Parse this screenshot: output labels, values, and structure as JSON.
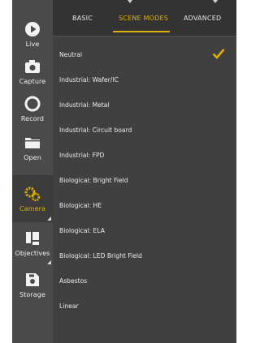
{
  "sidebar": {
    "items": [
      {
        "label": "Live",
        "icon": "play-icon"
      },
      {
        "label": "Capture",
        "icon": "camera-icon"
      },
      {
        "label": "Record",
        "icon": "record-icon"
      },
      {
        "label": "Open",
        "icon": "folder-icon"
      },
      {
        "label": "Camera",
        "icon": "camera-settings-icon",
        "active": true
      },
      {
        "label": "Objectives",
        "icon": "objectives-icon"
      },
      {
        "label": "Storage",
        "icon": "storage-icon"
      }
    ]
  },
  "tabs": [
    {
      "label": "BASIC"
    },
    {
      "label": "SCENE MODES",
      "active": true
    },
    {
      "label": "ADVANCED"
    }
  ],
  "scene_modes": {
    "selected": "Neutral",
    "items": [
      "Neutral",
      "Industrial: Wafer/IC",
      "Industrial: Metal",
      "Industrial: Circuit board",
      "Industrial: FPD",
      "Biological: Bright Field",
      "Biological: HE",
      "Biological: ELA",
      "Biological: LED Bright Field",
      "Asbestos",
      "Linear"
    ]
  },
  "colors": {
    "accent": "#e0b000",
    "panel": "#404040",
    "sidebar": "#4a4a4a"
  }
}
